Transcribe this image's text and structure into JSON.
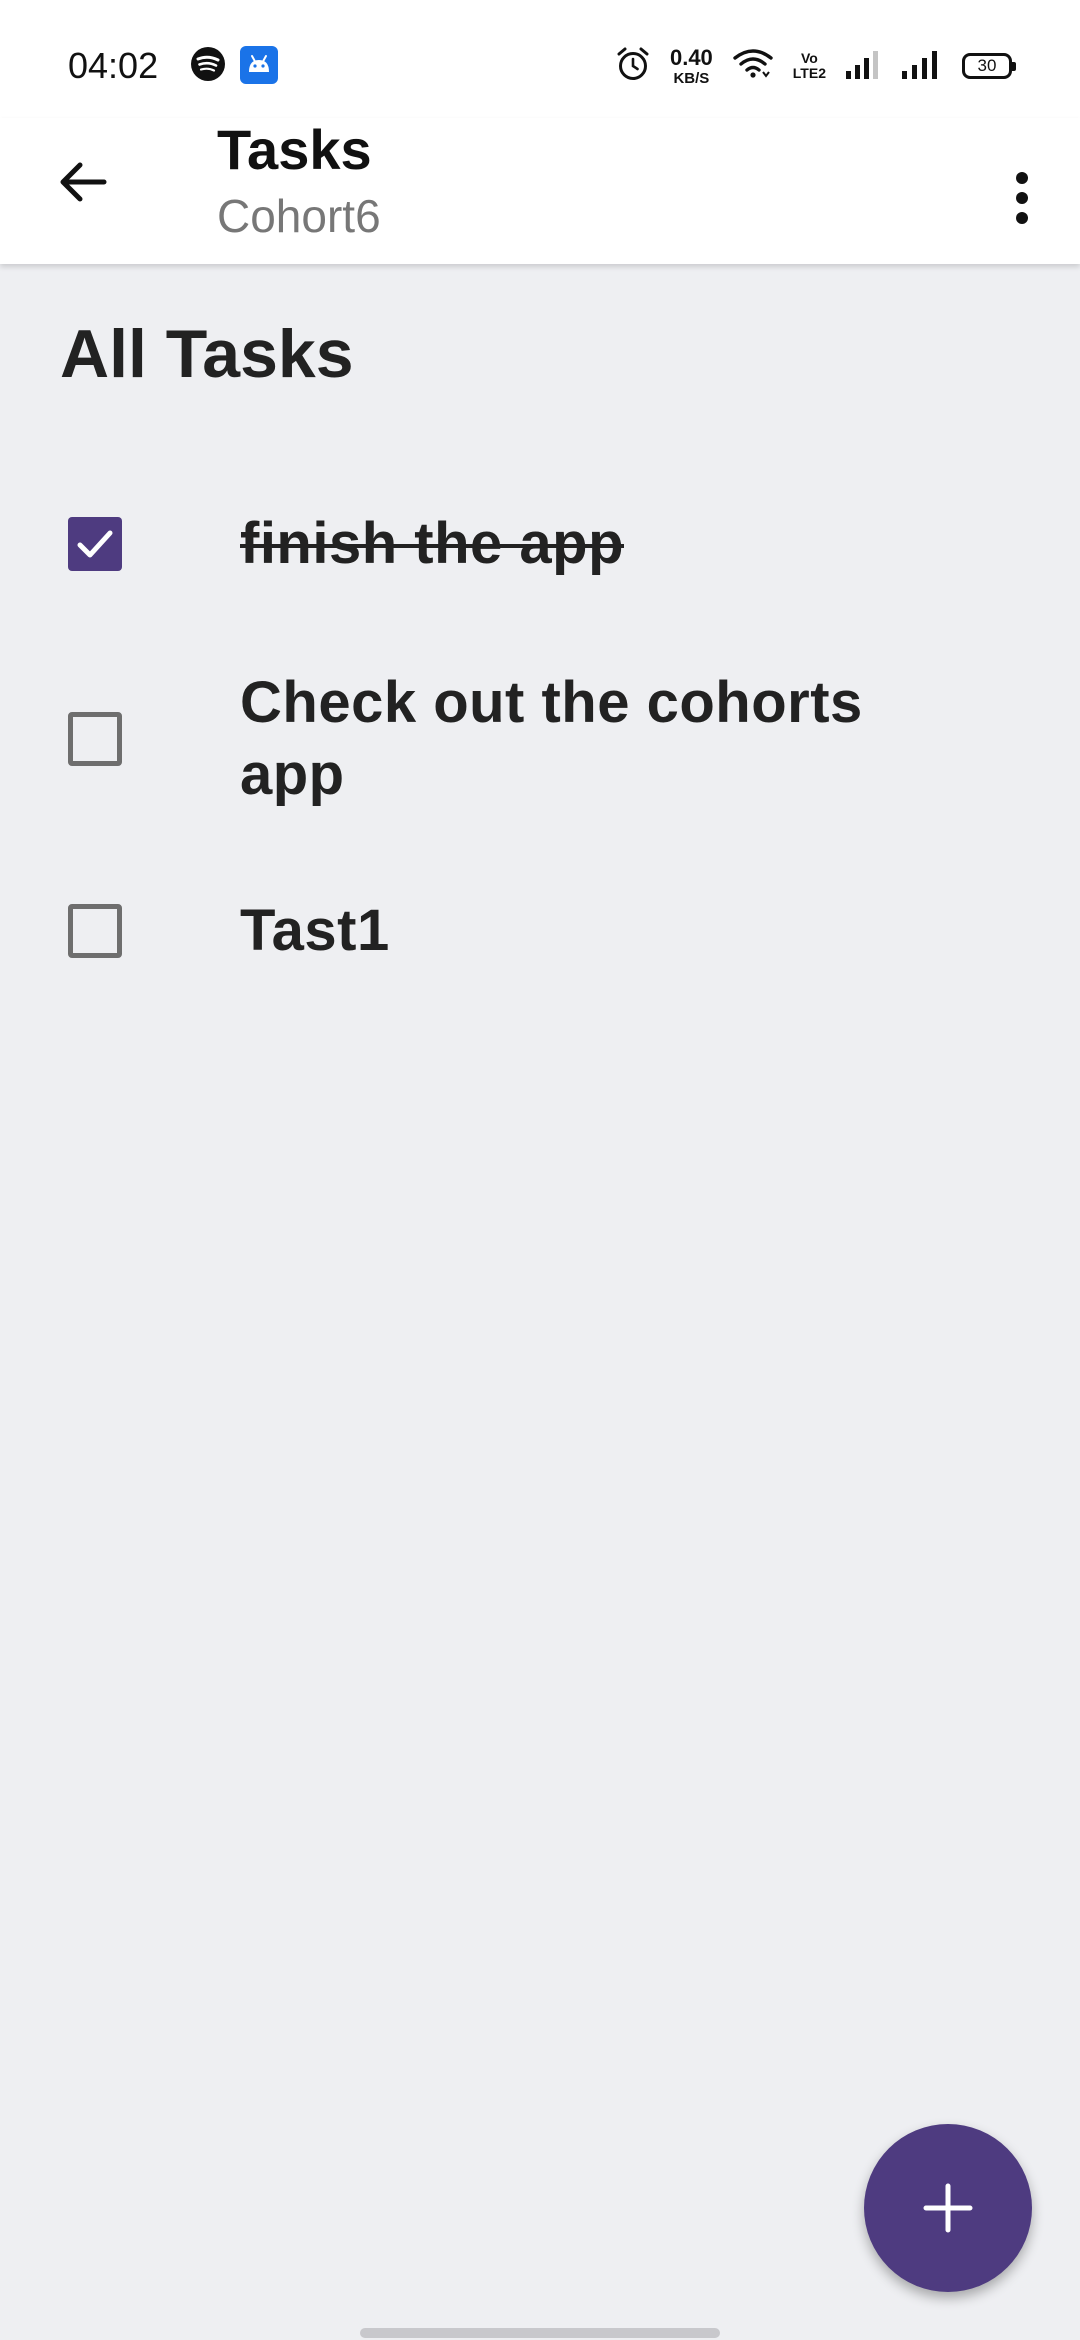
{
  "status_bar": {
    "time": "04:02",
    "net_speed_value": "0.40",
    "net_speed_unit": "KB/S",
    "volte_top": "Vo",
    "volte_bottom": "LTE2",
    "battery_level": "30",
    "icons": [
      "spotify-icon",
      "android-debug-icon",
      "alarm-icon",
      "wifi-icon",
      "signal-icon",
      "signal-icon",
      "battery-icon"
    ]
  },
  "app_bar": {
    "title": "Tasks",
    "subtitle": "Cohort6",
    "back_icon": "arrow-left-icon",
    "menu_icon": "more-vert-icon"
  },
  "main": {
    "heading": "All Tasks",
    "tasks": [
      {
        "label": "finish the app",
        "checked": true
      },
      {
        "label": "Check out the cohorts app",
        "checked": false
      },
      {
        "label": "Tast1",
        "checked": false
      }
    ]
  },
  "fab": {
    "icon": "plus-icon"
  },
  "colors": {
    "accent": "#4e3b80",
    "background": "#eeeff2",
    "surface": "#ffffff"
  }
}
